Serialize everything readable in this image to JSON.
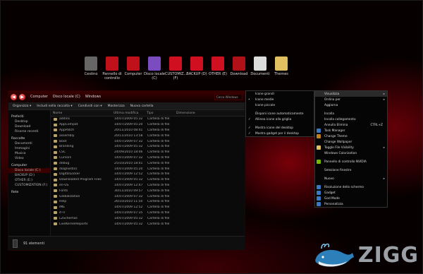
{
  "desktop_icons": [
    {
      "label": "Cestino",
      "icon": "trash-icon",
      "color": "#666666"
    },
    {
      "label": "Pannello di controllo",
      "icon": "control-panel-icon",
      "color": "#c0101a"
    },
    {
      "label": "Computer",
      "icon": "computer-icon",
      "color": "#c0101a"
    },
    {
      "label": "Disco locale (C)",
      "icon": "drive-icon",
      "color": "#7a4cc0"
    },
    {
      "label": "CUSTOMIZ... (F)",
      "icon": "drive-icon",
      "color": "#d01020"
    },
    {
      "label": "BACKUP (D)",
      "icon": "drive-icon",
      "color": "#d01020"
    },
    {
      "label": "OTHER (E)",
      "icon": "drive-icon",
      "color": "#d01020"
    },
    {
      "label": "Download",
      "icon": "download-icon",
      "color": "#b01018"
    },
    {
      "label": "Documenti",
      "icon": "documents-icon",
      "color": "#dddddd"
    },
    {
      "label": "Themes",
      "icon": "folder-icon",
      "color": "#e0c060"
    }
  ],
  "explorer": {
    "breadcrumb": [
      "Computer",
      "Disco locale (C)",
      "Windows"
    ],
    "search_placeholder": "Cerca Windows",
    "toolbar": [
      "Organizza ▾",
      "Includi nella raccolta ▾",
      "Condividi con ▾",
      "Masterizza",
      "Nuova cartella"
    ],
    "columns": [
      "Nome",
      "Ultima modifica",
      "Tipo",
      "Dimensione"
    ],
    "nav": [
      {
        "label": "Preferiti",
        "hdr": true
      },
      {
        "label": "Desktop"
      },
      {
        "label": "Download"
      },
      {
        "label": "Risorse recenti"
      },
      {
        "label": "Raccolte",
        "hdr": true
      },
      {
        "label": "Documenti"
      },
      {
        "label": "Immagini"
      },
      {
        "label": "Musica"
      },
      {
        "label": "Video"
      },
      {
        "label": "Computer",
        "hdr": true
      },
      {
        "label": "Disco locale (C:)",
        "sel": true
      },
      {
        "label": "BACKUP (D:)"
      },
      {
        "label": "OTHER (E:)"
      },
      {
        "label": "CUSTOMIZATION (F:)"
      },
      {
        "label": "Rete",
        "hdr": true
      }
    ],
    "rows": [
      {
        "name": "addins",
        "date": "14/07/2009 05:32",
        "type": "Cartella di file"
      },
      {
        "name": "AppCompat",
        "date": "14/07/2009 05:20",
        "type": "Cartella di file"
      },
      {
        "name": "AppPatch",
        "date": "20/11/2010 08:41",
        "type": "Cartella di file"
      },
      {
        "name": "assembly",
        "date": "20/11/2010 13:58",
        "type": "Cartella di file"
      },
      {
        "name": "Boot",
        "date": "14/07/2009 07:32",
        "type": "Cartella di file"
      },
      {
        "name": "Branding",
        "date": "14/07/2009 05:32",
        "type": "Cartella di file"
      },
      {
        "name": "CSC",
        "date": "24/09/2010 18:46",
        "type": "Cartella di file"
      },
      {
        "name": "Cursors",
        "date": "14/07/2009 07:32",
        "type": "Cartella di file"
      },
      {
        "name": "debug",
        "date": "25/10/2010 18:41",
        "type": "Cartella di file"
      },
      {
        "name": "diagnostics",
        "date": "14/07/2009 05:20",
        "type": "Cartella di file"
      },
      {
        "name": "DigitalLocker",
        "date": "14/07/2009 12:52",
        "type": "Cartella di file"
      },
      {
        "name": "Downloaded Program Files",
        "date": "14/07/2009 05:32",
        "type": "Cartella di file"
      },
      {
        "name": "en-US",
        "date": "14/07/2009 12:47",
        "type": "Cartella di file"
      },
      {
        "name": "Fonts",
        "date": "30/11/2010 09:57",
        "type": "Cartella di file"
      },
      {
        "name": "Globalization",
        "date": "14/07/2009 07:32",
        "type": "Cartella di file"
      },
      {
        "name": "Help",
        "date": "26/10/2010 11:50",
        "type": "Cartella di file"
      },
      {
        "name": "IME",
        "date": "14/07/2009 12:52",
        "type": "Cartella di file"
      },
      {
        "name": "it-IT",
        "date": "14/07/2009 07:35",
        "type": "Cartella di file"
      },
      {
        "name": "L2Schemas",
        "date": "14/07/2009 05:32",
        "type": "Cartella di file"
      },
      {
        "name": "LiveKernelReports",
        "date": "14/07/2009 05:32",
        "type": "Cartella di file"
      }
    ],
    "status": "91 elementi"
  },
  "view_submenu": {
    "items": [
      {
        "label": "Icone grandi",
        "mark": ""
      },
      {
        "label": "Icone medie",
        "mark": "•"
      },
      {
        "label": "Icone piccole",
        "mark": ""
      },
      {
        "sep": true
      },
      {
        "label": "Disponi icone automaticamente",
        "mark": ""
      },
      {
        "label": "Allinea icone alla griglia",
        "mark": "✓"
      },
      {
        "sep": true
      },
      {
        "label": "Mostra icone del desktop",
        "mark": "✓"
      },
      {
        "label": "Mostra gadget per il desktop",
        "mark": "✓"
      }
    ]
  },
  "context_menu": {
    "items": [
      {
        "label": "Visualizza",
        "arrow": true,
        "hl": true
      },
      {
        "label": "Ordina per",
        "arrow": true
      },
      {
        "label": "Aggiorna"
      },
      {
        "sep": true
      },
      {
        "label": "Incolla"
      },
      {
        "label": "Incolla collegamento"
      },
      {
        "label": "Annulla Elimina",
        "shortcut": "CTRL+Z"
      },
      {
        "label": "Task Manager",
        "icon": "#3a78c0"
      },
      {
        "label": "Change Theme",
        "icon": "#c08020"
      },
      {
        "label": "Change Wallpaper"
      },
      {
        "label": "Toggle File Visibility",
        "arrow": true,
        "icon": "#e0c060"
      },
      {
        "label": "Windows Colorization"
      },
      {
        "sep": true
      },
      {
        "label": "Pannello di controllo NVIDIA",
        "icon": "#76b900"
      },
      {
        "sep": true
      },
      {
        "label": "Selezione finestre"
      },
      {
        "sep": true
      },
      {
        "label": "Nuovo",
        "arrow": true
      },
      {
        "sep": true
      },
      {
        "label": "Risoluzione dello schermo",
        "icon": "#3a78c0"
      },
      {
        "label": "Gadget",
        "icon": "#3a78c0"
      },
      {
        "label": "God Mode",
        "icon": "#3a78c0"
      },
      {
        "label": "Personalizza",
        "icon": "#3a78c0"
      }
    ]
  },
  "watermark": {
    "text": "ZIGG",
    "color": "#9aa0a6"
  }
}
